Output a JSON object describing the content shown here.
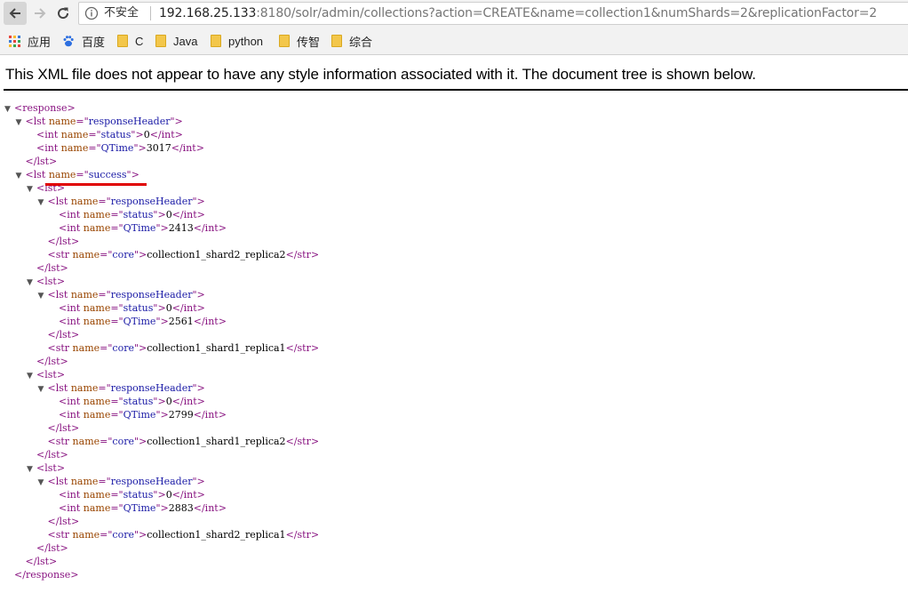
{
  "browser": {
    "back_icon": "arrow-left-icon",
    "forward_icon": "arrow-right-icon",
    "reload_icon": "reload-icon",
    "security_label": "不安全",
    "url_host": "192.168.25.133",
    "url_rest": ":8180/solr/admin/collections?action=CREATE&name=collection1&numShards=2&replicationFactor=2"
  },
  "bookmarks": [
    {
      "label": "应用",
      "icon": "apps-grid-icon"
    },
    {
      "label": "百度",
      "icon": "baidu-paw-icon"
    },
    {
      "label": "C",
      "icon": "folder-icon"
    },
    {
      "label": "Java",
      "icon": "folder-icon"
    },
    {
      "label": "python",
      "icon": "folder-icon"
    },
    {
      "label": "传智",
      "icon": "folder-icon"
    },
    {
      "label": "综合",
      "icon": "folder-icon"
    }
  ],
  "xml_viewer": {
    "notice": "This XML file does not appear to have any style information associated with it. The document tree is shown below."
  },
  "xml_tree": [
    {
      "indent": 0,
      "toggle": "▼",
      "tag": "response"
    },
    {
      "indent": 1,
      "toggle": "▼",
      "tag": "lst",
      "attr": "name",
      "value": "responseHeader"
    },
    {
      "indent": 2,
      "tag": "int",
      "attr": "name",
      "value": "status",
      "text": "0",
      "close": "int"
    },
    {
      "indent": 2,
      "tag": "int",
      "attr": "name",
      "value": "QTime",
      "text": "3017",
      "close": "int"
    },
    {
      "indent": 1,
      "close": "lst"
    },
    {
      "indent": 1,
      "toggle": "▼",
      "tag": "lst",
      "attr": "name",
      "value": "success"
    },
    {
      "indent": 2,
      "toggle": "▼",
      "tag": "lst"
    },
    {
      "indent": 3,
      "toggle": "▼",
      "tag": "lst",
      "attr": "name",
      "value": "responseHeader"
    },
    {
      "indent": 4,
      "tag": "int",
      "attr": "name",
      "value": "status",
      "text": "0",
      "close": "int"
    },
    {
      "indent": 4,
      "tag": "int",
      "attr": "name",
      "value": "QTime",
      "text": "2413",
      "close": "int"
    },
    {
      "indent": 3,
      "close": "lst"
    },
    {
      "indent": 3,
      "tag": "str",
      "attr": "name",
      "value": "core",
      "text": "collection1_shard2_replica2",
      "close": "str"
    },
    {
      "indent": 2,
      "close": "lst"
    },
    {
      "indent": 2,
      "toggle": "▼",
      "tag": "lst"
    },
    {
      "indent": 3,
      "toggle": "▼",
      "tag": "lst",
      "attr": "name",
      "value": "responseHeader"
    },
    {
      "indent": 4,
      "tag": "int",
      "attr": "name",
      "value": "status",
      "text": "0",
      "close": "int"
    },
    {
      "indent": 4,
      "tag": "int",
      "attr": "name",
      "value": "QTime",
      "text": "2561",
      "close": "int"
    },
    {
      "indent": 3,
      "close": "lst"
    },
    {
      "indent": 3,
      "tag": "str",
      "attr": "name",
      "value": "core",
      "text": "collection1_shard1_replica1",
      "close": "str"
    },
    {
      "indent": 2,
      "close": "lst"
    },
    {
      "indent": 2,
      "toggle": "▼",
      "tag": "lst"
    },
    {
      "indent": 3,
      "toggle": "▼",
      "tag": "lst",
      "attr": "name",
      "value": "responseHeader"
    },
    {
      "indent": 4,
      "tag": "int",
      "attr": "name",
      "value": "status",
      "text": "0",
      "close": "int"
    },
    {
      "indent": 4,
      "tag": "int",
      "attr": "name",
      "value": "QTime",
      "text": "2799",
      "close": "int"
    },
    {
      "indent": 3,
      "close": "lst"
    },
    {
      "indent": 3,
      "tag": "str",
      "attr": "name",
      "value": "core",
      "text": "collection1_shard1_replica2",
      "close": "str"
    },
    {
      "indent": 2,
      "close": "lst"
    },
    {
      "indent": 2,
      "toggle": "▼",
      "tag": "lst"
    },
    {
      "indent": 3,
      "toggle": "▼",
      "tag": "lst",
      "attr": "name",
      "value": "responseHeader"
    },
    {
      "indent": 4,
      "tag": "int",
      "attr": "name",
      "value": "status",
      "text": "0",
      "close": "int"
    },
    {
      "indent": 4,
      "tag": "int",
      "attr": "name",
      "value": "QTime",
      "text": "2883",
      "close": "int"
    },
    {
      "indent": 3,
      "close": "lst"
    },
    {
      "indent": 3,
      "tag": "str",
      "attr": "name",
      "value": "core",
      "text": "collection1_shard2_replica1",
      "close": "str"
    },
    {
      "indent": 2,
      "close": "lst"
    },
    {
      "indent": 1,
      "close": "lst"
    },
    {
      "indent": 0,
      "close": "response"
    }
  ]
}
